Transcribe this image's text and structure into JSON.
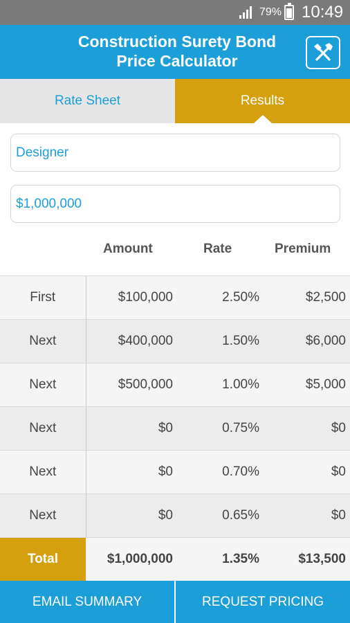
{
  "status_bar": {
    "battery": "79%",
    "time": "10:49"
  },
  "app_bar": {
    "title_line1": "Construction Surety Bond",
    "title_line2": "Price Calculator",
    "icon": "tools-icon"
  },
  "tabs": {
    "rate_sheet": "Rate Sheet",
    "results": "Results"
  },
  "inputs": {
    "bond_type": "Designer",
    "contract_amount": "$1,000,000"
  },
  "table": {
    "headers": {
      "amount": "Amount",
      "rate": "Rate",
      "premium": "Premium"
    },
    "rows": [
      {
        "label": "First",
        "amount": "$100,000",
        "rate": "2.50%",
        "premium": "$2,500"
      },
      {
        "label": "Next",
        "amount": "$400,000",
        "rate": "1.50%",
        "premium": "$6,000"
      },
      {
        "label": "Next",
        "amount": "$500,000",
        "rate": "1.00%",
        "premium": "$5,000"
      },
      {
        "label": "Next",
        "amount": "$0",
        "rate": "0.75%",
        "premium": "$0"
      },
      {
        "label": "Next",
        "amount": "$0",
        "rate": "0.70%",
        "premium": "$0"
      },
      {
        "label": "Next",
        "amount": "$0",
        "rate": "0.65%",
        "premium": "$0"
      }
    ],
    "total": {
      "label": "Total",
      "amount": "$1,000,000",
      "rate": "1.35%",
      "premium": "$13,500"
    }
  },
  "buttons": {
    "email_summary": "EMAIL SUMMARY",
    "request_pricing": "REQUEST PRICING"
  },
  "colors": {
    "primary_blue": "#1c9fd9",
    "gold": "#d4a00d",
    "status_gray": "#7a7a7a"
  }
}
